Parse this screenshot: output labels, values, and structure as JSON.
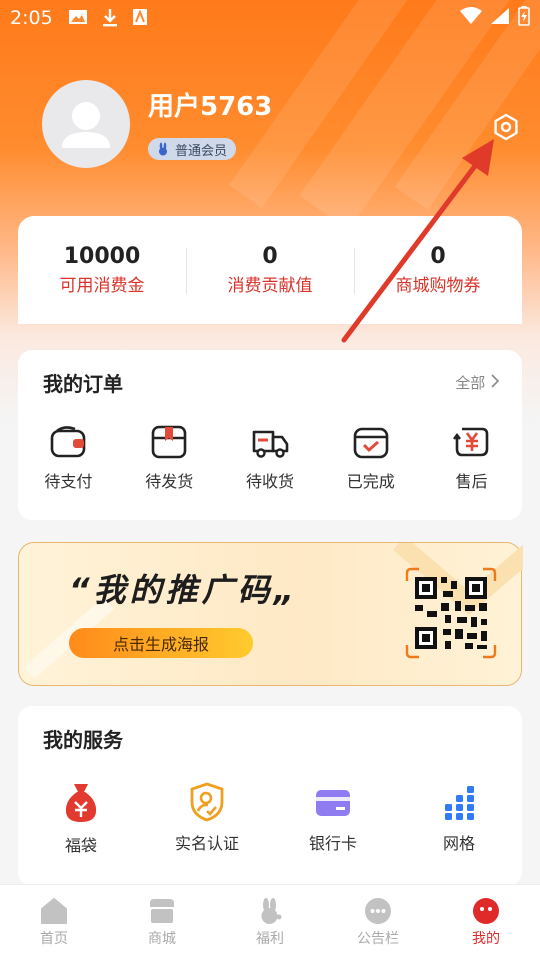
{
  "status_bar": {
    "time": "2:05"
  },
  "profile": {
    "username": "用户5763",
    "member_label": "普通会员"
  },
  "stats": [
    {
      "value": "10000",
      "label": "可用消费金"
    },
    {
      "value": "0",
      "label": "消费贡献值"
    },
    {
      "value": "0",
      "label": "商城购物券"
    }
  ],
  "orders": {
    "title": "我的订单",
    "all_label": "全部",
    "items": [
      {
        "label": "待支付",
        "icon": "wallet-icon"
      },
      {
        "label": "待发货",
        "icon": "package-icon"
      },
      {
        "label": "待收货",
        "icon": "truck-icon"
      },
      {
        "label": "已完成",
        "icon": "calendar-check-icon"
      },
      {
        "label": "售后",
        "icon": "yen-refresh-icon"
      }
    ]
  },
  "promo": {
    "title": "“我的推广码„",
    "button": "点击生成海报"
  },
  "services": {
    "title": "我的服务",
    "items": [
      {
        "label": "福袋",
        "icon": "lucky-bag-icon"
      },
      {
        "label": "实名认证",
        "icon": "id-verify-icon"
      },
      {
        "label": "银行卡",
        "icon": "bank-card-icon"
      },
      {
        "label": "网格",
        "icon": "grid-icon"
      }
    ]
  },
  "tabbar": [
    {
      "label": "首页",
      "icon": "home-icon"
    },
    {
      "label": "商城",
      "icon": "store-icon"
    },
    {
      "label": "福利",
      "icon": "rabbit-icon"
    },
    {
      "label": "公告栏",
      "icon": "chat-bubble-icon"
    },
    {
      "label": "我的",
      "icon": "profile-icon",
      "active": true
    }
  ],
  "colors": {
    "accent": "#ff7a1a",
    "stat_label": "#d9342b",
    "active_tab": "#e02a2a"
  }
}
